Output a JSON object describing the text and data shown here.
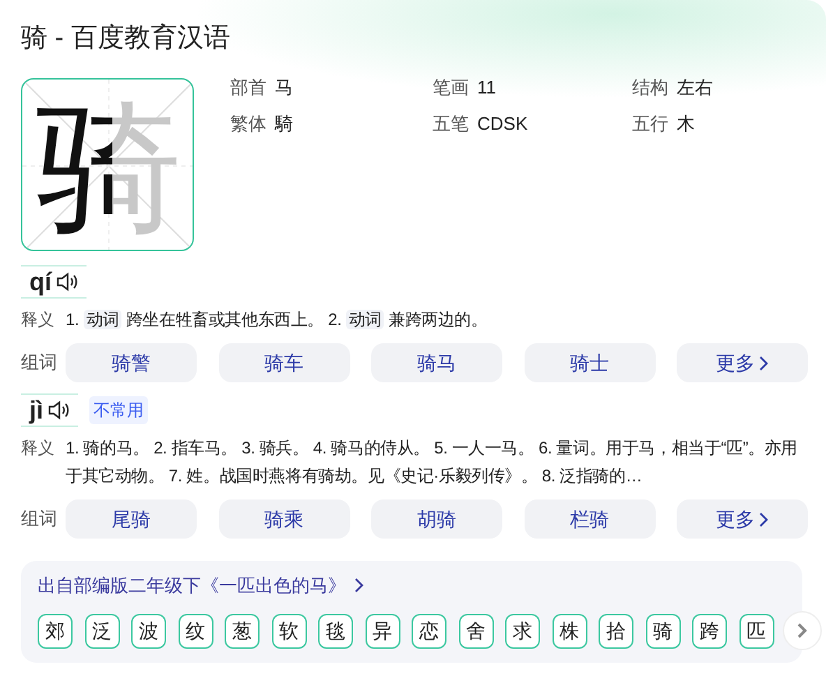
{
  "title": "骑 - 百度教育汉语",
  "character": "骑",
  "info": [
    {
      "label": "部首",
      "value": "马"
    },
    {
      "label": "笔画",
      "value": "11"
    },
    {
      "label": "结构",
      "value": "左右"
    },
    {
      "label": "繁体",
      "value": "騎"
    },
    {
      "label": "五笔",
      "value": "CDSK"
    },
    {
      "label": "五行",
      "value": "木"
    }
  ],
  "readings": [
    {
      "pinyin": "qí",
      "definition_label": "释义",
      "definitions": [
        {
          "num": "1.",
          "pos": "动词",
          "text": "跨坐在牲畜或其他东西上。"
        },
        {
          "num": "2.",
          "pos": "动词",
          "text": "兼跨两边的。"
        }
      ],
      "words_label": "组词",
      "words": [
        "骑警",
        "骑车",
        "骑马",
        "骑士"
      ],
      "more": "更多"
    },
    {
      "pinyin": "jì",
      "tag": "不常用",
      "definition_label": "释义",
      "definitions": [
        {
          "text": "1. 骑的马。 2. 指车马。 3. 骑兵。 4. 骑马的侍从。 5. 一人一马。 6. 量词。用于马，相当于“匹”。亦用于其它动物。 7. 姓。战国时燕将有骑劫。见《史记·乐毅列传》。 8. 泛指骑的…"
        }
      ],
      "words_label": "组词",
      "words": [
        "尾骑",
        "骑乘",
        "胡骑",
        "栏骑"
      ],
      "more": "更多"
    }
  ],
  "textbook": {
    "title": "出自部编版二年级下《一匹出色的马》",
    "chars": [
      "郊",
      "泛",
      "波",
      "纹",
      "葱",
      "软",
      "毯",
      "异",
      "恋",
      "舍",
      "求",
      "株",
      "拾",
      "骑",
      "跨",
      "匹"
    ]
  }
}
